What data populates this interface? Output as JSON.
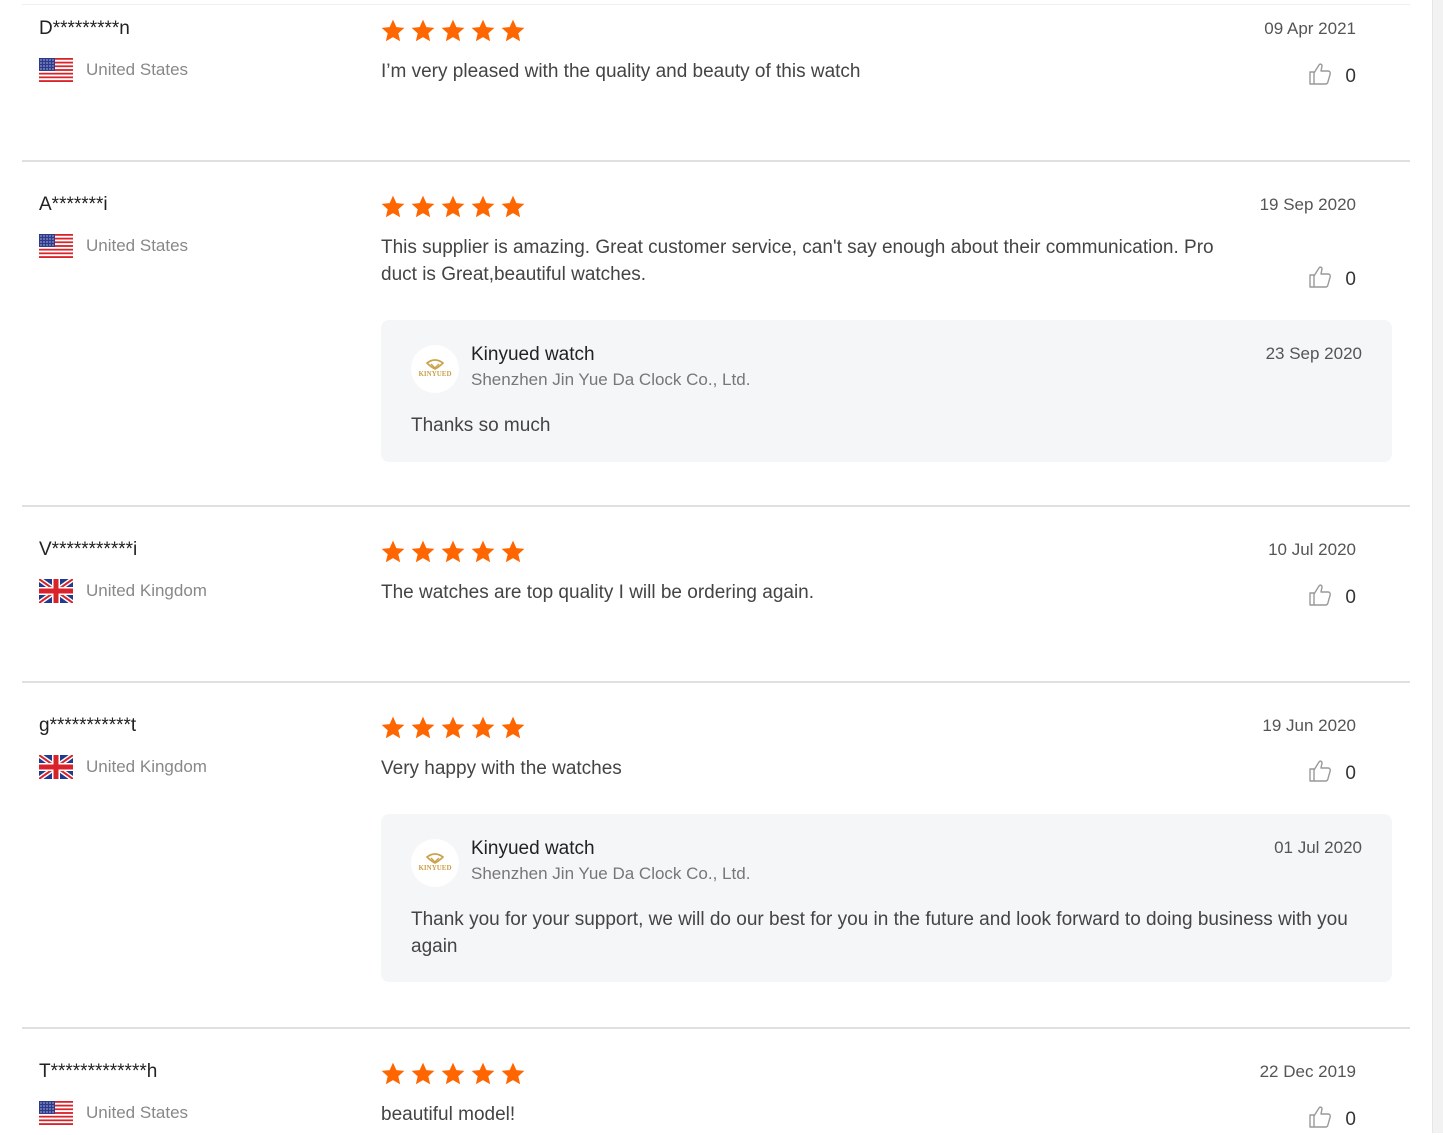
{
  "colors": {
    "star": "#ff6600",
    "divider": "#e0e0e0",
    "reply_bg": "#f5f6f8"
  },
  "icons": {
    "star": "star-icon",
    "like": "thumbs-up-icon",
    "flag_us": "us-flag-icon",
    "flag_uk": "uk-flag-icon",
    "supplier_logo": "kinyued-logo-icon"
  },
  "reviews": [
    {
      "user": "D*********n",
      "country": "United States",
      "flag": "us",
      "rating": 5,
      "date": "09 Apr 2021",
      "text": "I’m very pleased with the quality and beauty of this watch",
      "likes": "0"
    },
    {
      "user": "A*******i",
      "country": "United States",
      "flag": "us",
      "rating": 5,
      "date": "19 Sep 2020",
      "text": "This supplier is amazing. Great customer service, can't say enough about their communication. Product is Great,beautiful watches.",
      "likes": "0",
      "reply": {
        "name": "Kinyued watch",
        "company": "Shenzhen Jin Yue Da Clock Co., Ltd.",
        "date": "23 Sep 2020",
        "text": "Thanks so much",
        "logo_text": "KINYUED"
      }
    },
    {
      "user": "V***********i",
      "country": "United Kingdom",
      "flag": "uk",
      "rating": 5,
      "date": "10 Jul 2020",
      "text": "The watches are top quality I will be ordering again.",
      "likes": "0"
    },
    {
      "user": "g***********t",
      "country": "United Kingdom",
      "flag": "uk",
      "rating": 5,
      "date": "19 Jun 2020",
      "text": "Very happy with the watches",
      "likes": "0",
      "reply": {
        "name": "Kinyued watch",
        "company": "Shenzhen Jin Yue Da Clock Co., Ltd.",
        "date": "01 Jul 2020",
        "text": "Thank you for your support, we will do our best for you in the future and look forward to doing business with you again",
        "logo_text": "KINYUED"
      }
    },
    {
      "user": "T*************h",
      "country": "United States",
      "flag": "us",
      "rating": 5,
      "date": "22 Dec 2019",
      "text": "beautiful model!",
      "likes": "0"
    }
  ]
}
